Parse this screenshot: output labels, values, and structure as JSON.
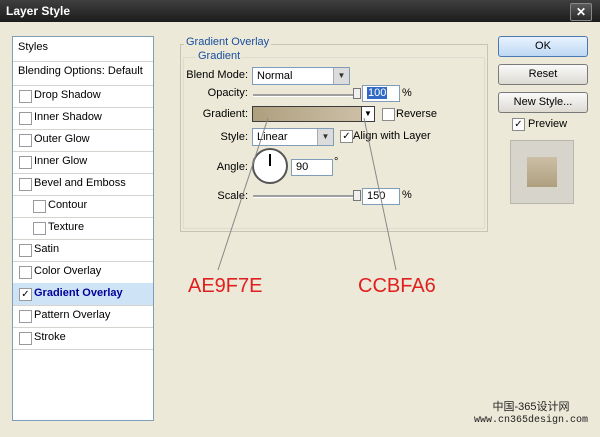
{
  "window": {
    "title": "Layer Style",
    "close_glyph": "✕"
  },
  "sidebar": {
    "header": "Styles",
    "blending": "Blending Options: Default",
    "items": [
      {
        "label": "Drop Shadow",
        "checked": false,
        "indent": false
      },
      {
        "label": "Inner Shadow",
        "checked": false,
        "indent": false
      },
      {
        "label": "Outer Glow",
        "checked": false,
        "indent": false
      },
      {
        "label": "Inner Glow",
        "checked": false,
        "indent": false
      },
      {
        "label": "Bevel and Emboss",
        "checked": false,
        "indent": false
      },
      {
        "label": "Contour",
        "checked": false,
        "indent": true
      },
      {
        "label": "Texture",
        "checked": false,
        "indent": true
      },
      {
        "label": "Satin",
        "checked": false,
        "indent": false
      },
      {
        "label": "Color Overlay",
        "checked": false,
        "indent": false
      },
      {
        "label": "Gradient Overlay",
        "checked": true,
        "indent": false,
        "selected": true
      },
      {
        "label": "Pattern Overlay",
        "checked": false,
        "indent": false
      },
      {
        "label": "Stroke",
        "checked": false,
        "indent": false
      }
    ]
  },
  "panel": {
    "title": "Gradient Overlay",
    "subtitle": "Gradient",
    "blend_mode": {
      "label": "Blend Mode:",
      "value": "Normal"
    },
    "opacity": {
      "label": "Opacity:",
      "value": "100",
      "unit": "%",
      "level": 1.0
    },
    "gradient": {
      "label": "Gradient:",
      "start_color": "#AE9F7E",
      "end_color": "#CCBFA6",
      "reverse_label": "Reverse",
      "reverse_checked": false
    },
    "style": {
      "label": "Style:",
      "value": "Linear",
      "align_label": "Align with Layer",
      "align_checked": true
    },
    "angle": {
      "label": "Angle:",
      "value": "90",
      "unit": "°"
    },
    "scale": {
      "label": "Scale:",
      "value": "150",
      "unit": "%",
      "level": 1.0
    }
  },
  "buttons": {
    "ok": "OK",
    "reset": "Reset",
    "new_style": "New Style...",
    "preview_label": "Preview",
    "preview_checked": true
  },
  "annotations": {
    "left_code": "AE9F7E",
    "right_code": "CCBFA6"
  },
  "watermark": {
    "line1": "中国-365设计网",
    "line2": "www.cn365design.com"
  }
}
